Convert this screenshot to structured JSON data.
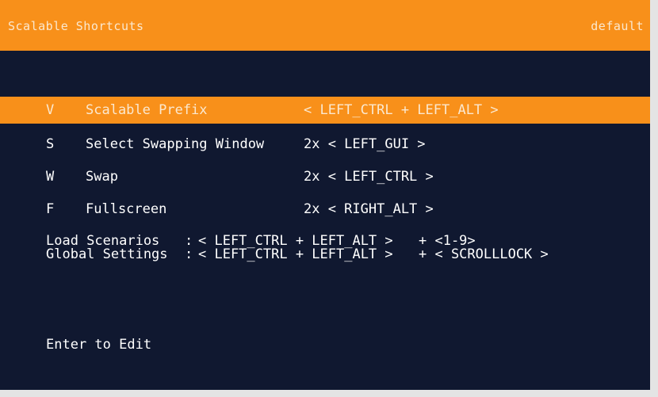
{
  "header": {
    "title": "Scalable Shortcuts",
    "profile": "default"
  },
  "colors": {
    "accent": "#f8901a",
    "background": "#101830",
    "text": "#ffffff"
  },
  "shortcuts": [
    {
      "key": "V",
      "label": "Scalable Prefix",
      "shortcut": "< LEFT_CTRL + LEFT_ALT >",
      "selected": true
    },
    {
      "key": "S",
      "label": "Select Swapping Window",
      "shortcut": "2x < LEFT_GUI >",
      "selected": false
    },
    {
      "key": "W",
      "label": "Swap",
      "shortcut": "2x < LEFT_CTRL >",
      "selected": false
    },
    {
      "key": "F",
      "label": "Fullscreen",
      "shortcut": "2x < RIGHT_ALT >",
      "selected": false
    }
  ],
  "info": [
    {
      "name": "Load Scenarios",
      "sep": ":",
      "combo": "< LEFT_CTRL + LEFT_ALT >",
      "suffix": "+ <1-9>"
    },
    {
      "name": "Global Settings",
      "sep": ":",
      "combo": "< LEFT_CTRL + LEFT_ALT >",
      "suffix": "+ < SCROLLLOCK >"
    }
  ],
  "footer": {
    "hint": "Enter to Edit"
  }
}
